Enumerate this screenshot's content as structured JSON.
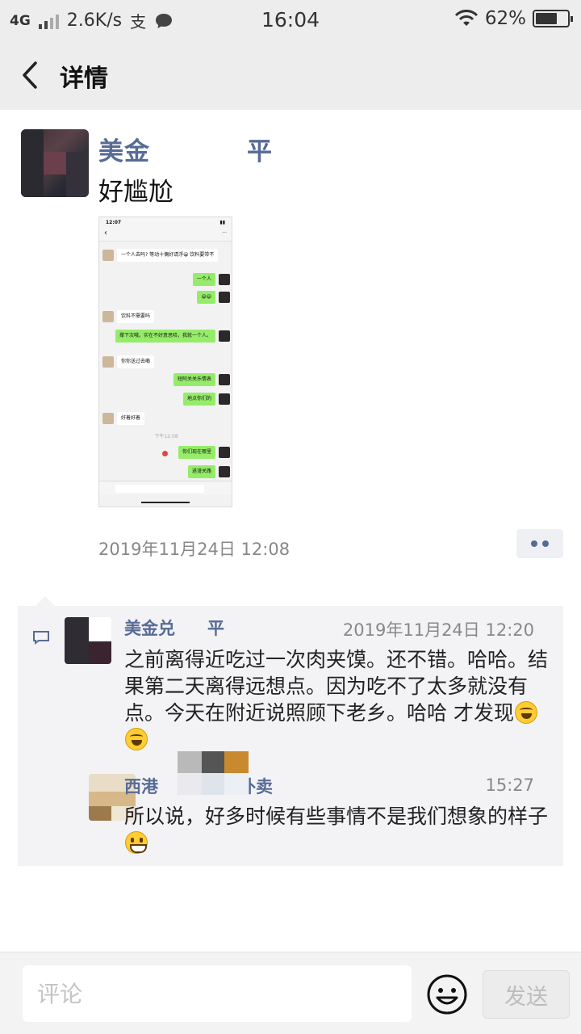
{
  "status_bar": {
    "network": "4G",
    "speed": "2.6K/s",
    "alipay_glyph": "支",
    "time": "16:04",
    "battery": "62%"
  },
  "header": {
    "back_icon": "chevron-left-icon",
    "title": "详情"
  },
  "post": {
    "author": "美金",
    "author_tail": "平",
    "text": "好尴尬",
    "timestamp": "2019年11月24日 12:08",
    "more_icon": "two-dots-icon",
    "screenshot": {
      "time": "12:07",
      "more": "···",
      "messages": [
        {
          "side": "left",
          "text": "一个人去吗? 等动十偶好请浮😀 饮料要带不"
        },
        {
          "side": "right",
          "text": "一个人"
        },
        {
          "side": "right",
          "text": "😄😄"
        },
        {
          "side": "left",
          "text": "饮料不需要吗"
        },
        {
          "side": "right",
          "text": "撑下次哦。实在不好意思哈，我就一个人。"
        },
        {
          "side": "left",
          "text": "你你送过去嘞"
        },
        {
          "side": "right",
          "text": "短阿关关乐情表"
        },
        {
          "side": "right",
          "text": "地点你们的"
        },
        {
          "side": "left",
          "text": "好着好着"
        },
        {
          "side": "center",
          "text": "下午12:08"
        },
        {
          "side": "right",
          "text": "你们现在哪里"
        },
        {
          "side": "right",
          "text": "遂漫关路"
        }
      ]
    }
  },
  "comments": {
    "icon": "comment-icon",
    "items": [
      {
        "name": "美金兑",
        "name_tail": "平",
        "time": "2019年11月24日 12:20",
        "text": "之前离得近吃过一次肉夹馍。还不错。哈哈。结果第二天离得远想点。因为吃不了太多就没有点。今天在附近说照顾下老乡。哈哈 才发现",
        "emoji": "face-with-tears-of-joy"
      },
      {
        "name": "西港",
        "name_tail": "外卖",
        "time": "15:27",
        "text": "所以说，好多时候有些事情不是我们想象的样子",
        "emoji": "grinning-face"
      }
    ]
  },
  "input_bar": {
    "placeholder": "评论",
    "emoji_icon": "smiley-icon",
    "send_label": "发送"
  },
  "colors": {
    "name_blue": "#576b95",
    "header_bg": "#ededed",
    "comment_bg": "#f3f3f5"
  }
}
